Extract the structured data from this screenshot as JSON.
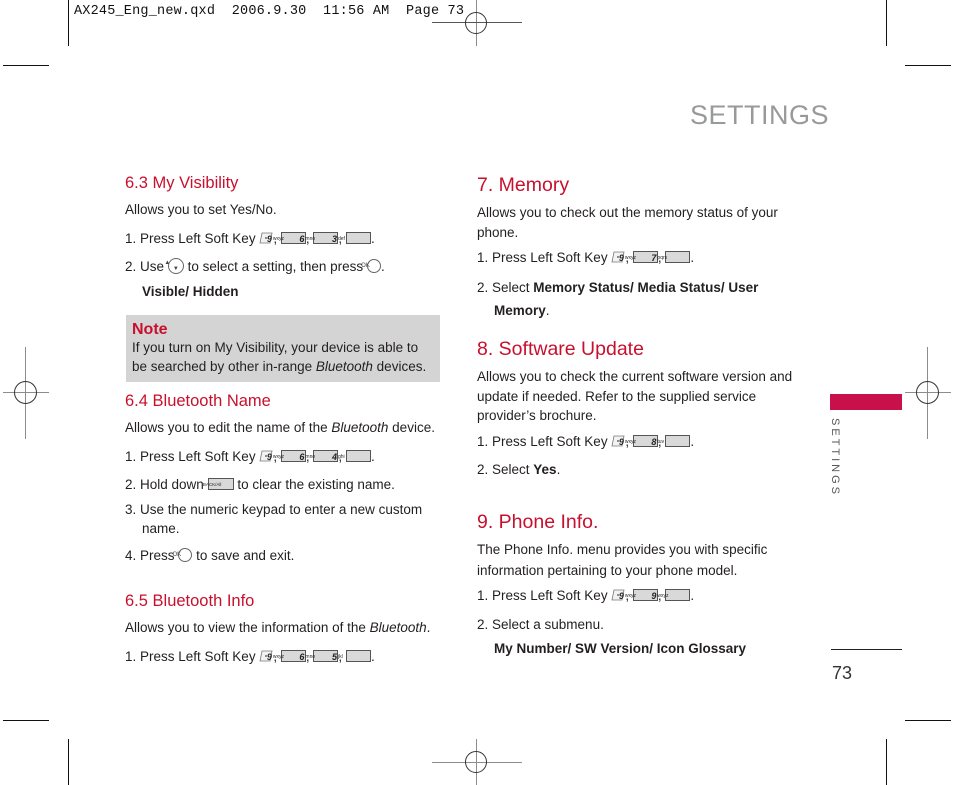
{
  "slug": "AX245_Eng_new.qxd  2006.9.30  11:56 AM  Page 73",
  "page_title": "SETTINGS",
  "side_tab": "SETTINGS",
  "page_number": "73",
  "colors": {
    "accent": "#c8102e",
    "side_tab": "#c8104a",
    "title_gray": "#98999b",
    "note_bg": "#d4d4d4"
  },
  "icons": {
    "left_soft_key": "left-soft-key-icon",
    "ok_key": "OK",
    "nav_key": "navigation-key-icon",
    "back_key": "BACK/All"
  },
  "keys": {
    "k9": {
      "num": "9",
      "letters": "wxyz"
    },
    "k6": {
      "num": "6",
      "letters": "mno"
    },
    "k3": {
      "num": "3",
      "letters": "def"
    },
    "k4": {
      "num": "4",
      "letters": "ghi"
    },
    "k5": {
      "num": "5",
      "letters": "jkl"
    },
    "k7": {
      "num": "7",
      "letters": "pqrs"
    },
    "k8": {
      "num": "8",
      "letters": "tuv"
    }
  },
  "s63": {
    "heading": "6.3 My Visibility",
    "desc": "Allows you to set Yes/No.",
    "step1": "1. Press Left Soft Key",
    "step2a": "2. Use",
    "step2b": "to select a setting, then press",
    "options": "Visible/ Hidden"
  },
  "note": {
    "title": "Note",
    "text_a": "If you turn on My Visibility, your device is able to be searched by other in-range ",
    "text_italic": "Bluetooth",
    "text_b": " devices."
  },
  "s64": {
    "heading": "6.4 Bluetooth Name",
    "desc_a": "Allows you to edit the name of the ",
    "desc_italic": "Bluetooth",
    "desc_b": " device.",
    "step1": "1. Press Left Soft Key",
    "step2a": "2. Hold down",
    "step2b": "to clear the existing name.",
    "step3": "3. Use the numeric keypad to enter a new custom name.",
    "step4a": "4. Press",
    "step4b": "to save and exit."
  },
  "s65": {
    "heading": "6.5 Bluetooth Info",
    "desc_a": "Allows you to view the information of the ",
    "desc_italic": "Bluetooth",
    "desc_b": ".",
    "step1": "1. Press Left Soft Key"
  },
  "s7": {
    "heading": "7. Memory",
    "desc": "Allows you to check out the memory status of your phone.",
    "step1": "1. Press Left Soft Key",
    "step2a": "2. Select ",
    "step2_bold": "Memory Status/ Media Status/ User Memory",
    "step2b": "."
  },
  "s8": {
    "heading": "8. Software Update",
    "desc": "Allows you to check the current software version and update if needed. Refer to the supplied service provider’s brochure.",
    "step1": "1. Press Left Soft Key",
    "step2a": "2. Select ",
    "step2_bold": "Yes",
    "step2b": "."
  },
  "s9": {
    "heading": "9. Phone Info.",
    "desc": "The Phone Info. menu provides you with specific information pertaining to your phone model.",
    "step1": "1. Press Left Soft Key",
    "step2": "2. Select a submenu.",
    "options": "My Number/ SW Version/ Icon Glossary"
  },
  "punct": {
    "comma": ",",
    "period": "."
  }
}
